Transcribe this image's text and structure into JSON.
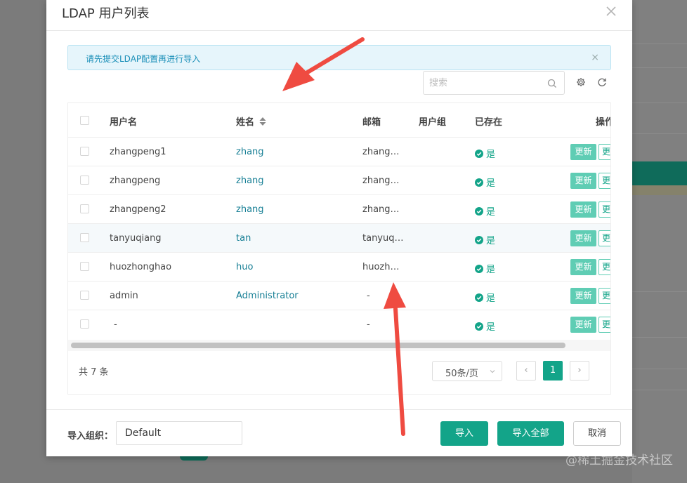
{
  "modal": {
    "title": "LDAP 用户列表"
  },
  "alert": {
    "text": "请先提交LDAP配置再进行导入",
    "close": "×"
  },
  "search": {
    "placeholder": "搜索"
  },
  "table": {
    "headers": {
      "user": "用户名",
      "name": "姓名",
      "mail": "邮箱",
      "group": "用户组",
      "exist": "已存在",
      "op": "操作"
    },
    "rows": [
      {
        "user": "zhangpeng1",
        "name": "zhang",
        "mail": "zhangp…",
        "group": "",
        "exist": "是",
        "upd": "更新",
        "more": "更"
      },
      {
        "user": "zhangpeng",
        "name": "zhang",
        "mail": "zhangp…",
        "group": "",
        "exist": "是",
        "upd": "更新",
        "more": "更"
      },
      {
        "user": "zhangpeng2",
        "name": "zhang",
        "mail": "zhangp…",
        "group": "",
        "exist": "是",
        "upd": "更新",
        "more": "更"
      },
      {
        "user": "tanyuqiang",
        "name": "tan",
        "mail": "tanyuqi…",
        "group": "",
        "exist": "是",
        "upd": "更新",
        "more": "更"
      },
      {
        "user": "huozhonghao",
        "name": "huo",
        "mail": "huozho…",
        "group": "",
        "exist": "是",
        "upd": "更新",
        "more": "更"
      },
      {
        "user": "admin",
        "name": "Administrator",
        "mail": "-",
        "group": "",
        "exist": "是",
        "upd": "更新",
        "more": "更"
      },
      {
        "user": "-",
        "name": "",
        "mail": "-",
        "group": "",
        "exist": "是",
        "upd": "更新",
        "more": "更"
      }
    ]
  },
  "pagination": {
    "total": "共 7 条",
    "page_size": "50条/页",
    "prev": "‹",
    "current": "1",
    "next": "›"
  },
  "footer": {
    "org_label": "导入组织：",
    "org_value": "Default",
    "import": "导入",
    "import_all": "导入全部",
    "cancel": "取消"
  },
  "watermark": "@稀土掘金技术社区",
  "colors": {
    "primary": "#13a489",
    "arrow": "#ef4b41",
    "alert_bg": "#e6f5fb"
  }
}
